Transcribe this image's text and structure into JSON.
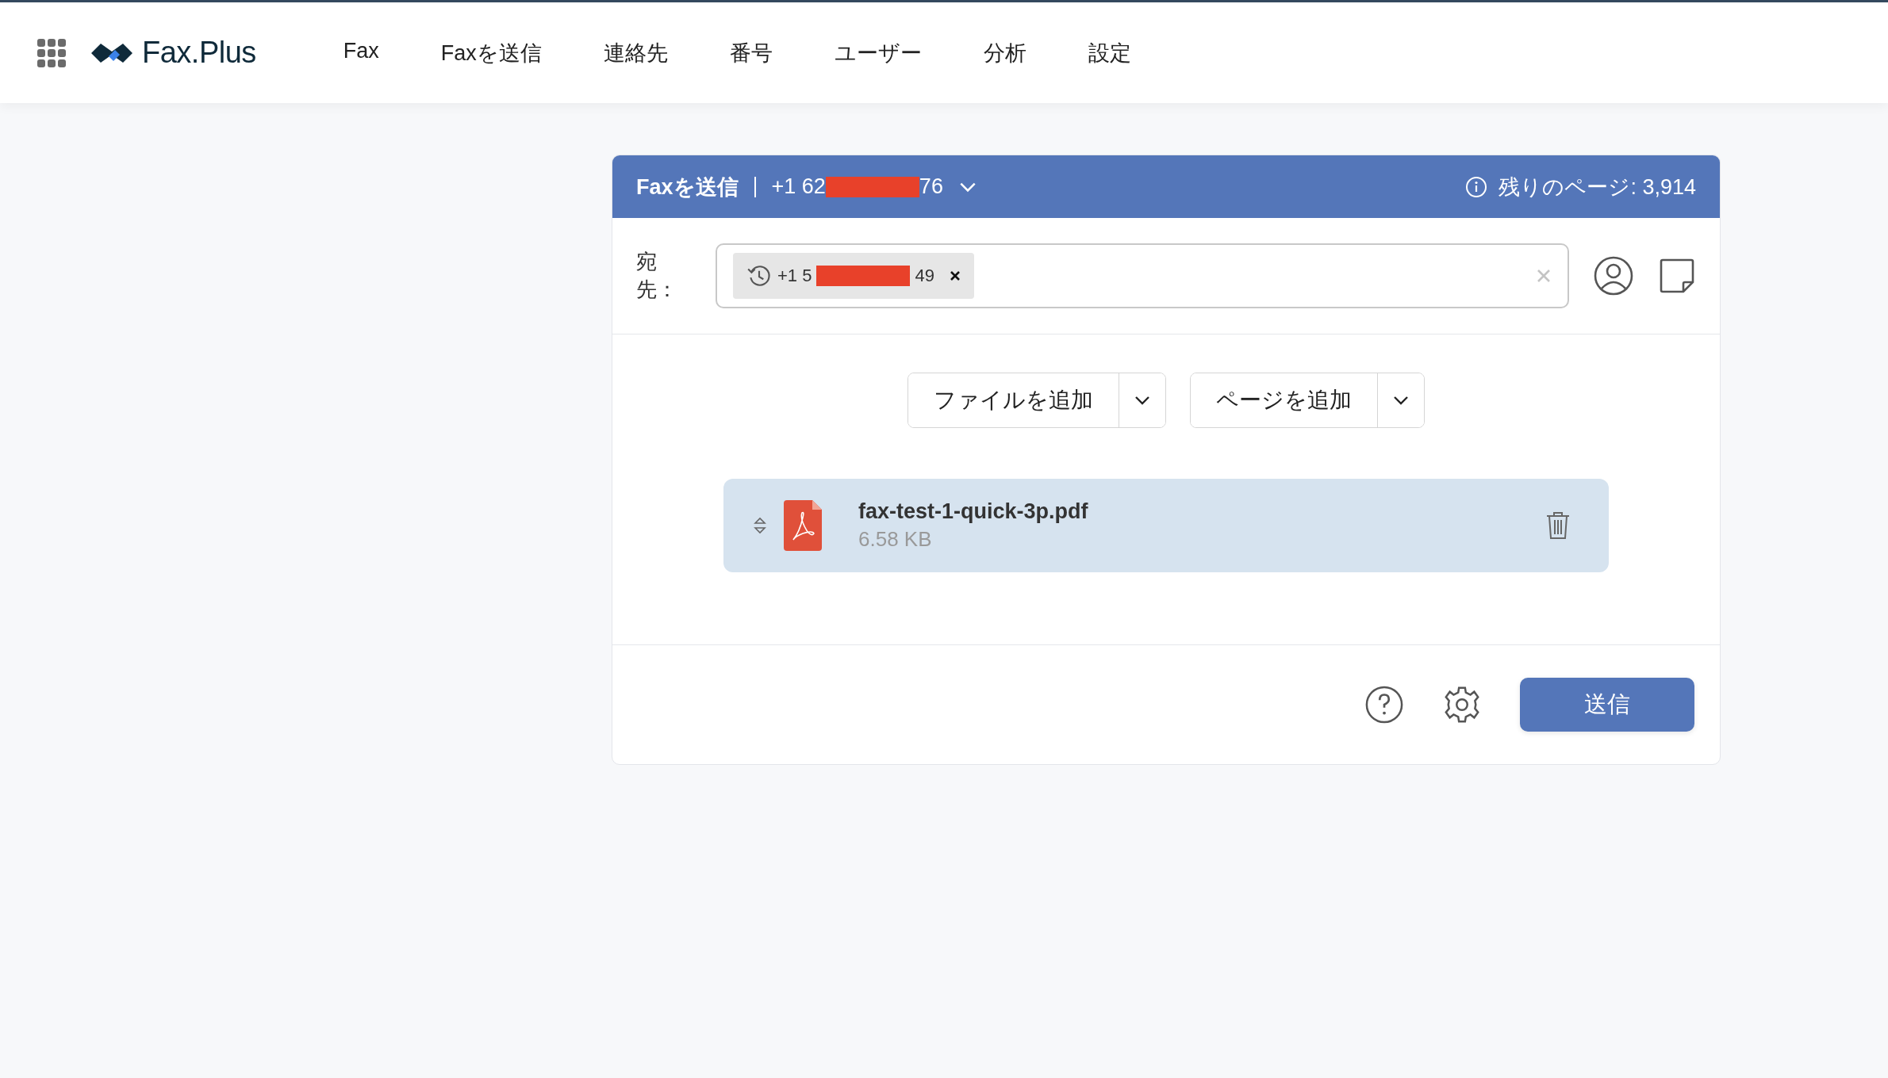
{
  "app": {
    "logo": "Fax.Plus"
  },
  "nav": [
    {
      "label": "Fax"
    },
    {
      "label": "Faxを送信"
    },
    {
      "label": "連絡先"
    },
    {
      "label": "番号"
    },
    {
      "label": "ユーザー"
    },
    {
      "label": "分析"
    },
    {
      "label": "設定"
    }
  ],
  "send_panel": {
    "title": "Faxを送信",
    "sender_prefix": "+1 62",
    "sender_suffix": "76",
    "pages_remaining": "残りのページ: 3,914"
  },
  "recipients": {
    "label": "宛先：",
    "chips": [
      {
        "prefix": "+1 5",
        "suffix": "49"
      }
    ]
  },
  "add_buttons": [
    {
      "label": "ファイルを追加"
    },
    {
      "label": "ページを追加"
    }
  ],
  "files": [
    {
      "name": "fax-test-1-quick-3p.pdf",
      "size": "6.58 KB"
    }
  ],
  "send_button": "送信"
}
